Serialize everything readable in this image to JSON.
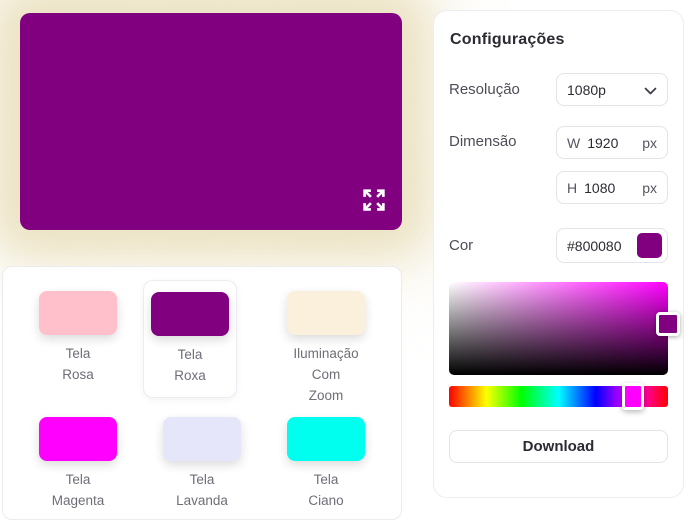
{
  "preview": {
    "color": "#800080"
  },
  "palette": {
    "items": [
      {
        "label": "Tela\nRosa",
        "color": "#ffc0cb",
        "selected": false
      },
      {
        "label": "Tela\nRoxa",
        "color": "#800080",
        "selected": true
      },
      {
        "label": "Iluminação\nCom\nZoom",
        "color": "#faf0dc",
        "selected": false
      },
      {
        "label": "Tela\nMagenta",
        "color": "#ff00ff",
        "selected": false
      },
      {
        "label": "Tela\nLavanda",
        "color": "#e6e6fa",
        "selected": false
      },
      {
        "label": "Tela\nCiano",
        "color": "#00ffef",
        "selected": false
      }
    ]
  },
  "settings": {
    "title": "Configurações",
    "resolution": {
      "label": "Resolução",
      "value": "1080p"
    },
    "dimension": {
      "label": "Dimensão",
      "width": {
        "prefix": "W",
        "value": "1920",
        "unit": "px"
      },
      "height": {
        "prefix": "H",
        "value": "1080",
        "unit": "px"
      }
    },
    "color": {
      "label": "Cor",
      "value": "#800080",
      "swatch": "#800080"
    },
    "picker": {
      "selected_color": "#800080",
      "hue_color": "#ff00ff"
    },
    "download_label": "Download"
  }
}
